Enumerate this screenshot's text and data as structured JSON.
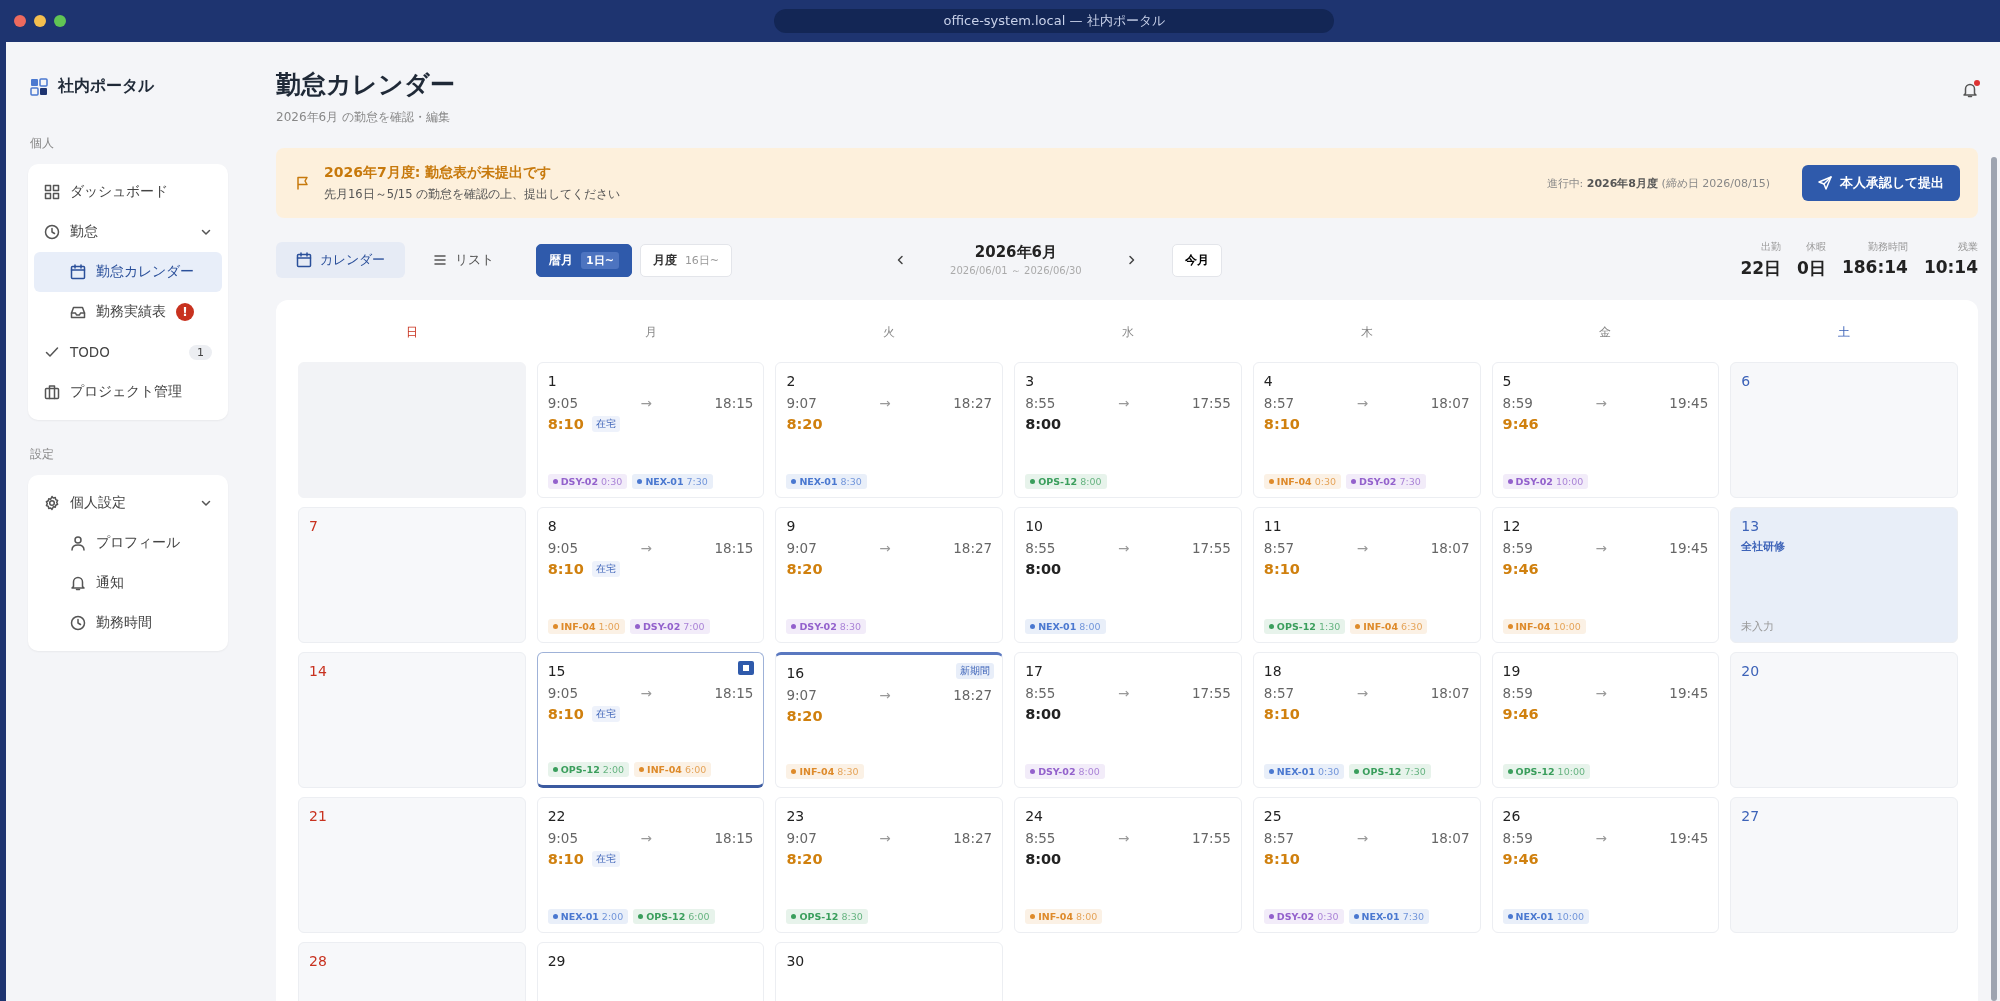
{
  "window": {
    "title": "office-system.local — 社内ポータル"
  },
  "sidebar": {
    "logo": "社内ポータル",
    "sections": [
      {
        "title": "個人",
        "items": [
          {
            "label": "ダッシュボード",
            "selected": false
          },
          {
            "label": "勤怠",
            "selected": false,
            "expanded": true,
            "children": [
              {
                "label": "勤怠カレンダー",
                "selected": true
              },
              {
                "label": "勤務実績表",
                "selected": false,
                "alert": "!"
              }
            ]
          },
          {
            "label": "TODO",
            "selected": false,
            "count": "1"
          },
          {
            "label": "プロジェクト管理",
            "selected": false
          }
        ]
      },
      {
        "title": "設定",
        "items": [
          {
            "label": "個人設定",
            "selected": false,
            "expanded": true,
            "children": [
              {
                "label": "プロフィール",
                "selected": false
              },
              {
                "label": "通知",
                "selected": false
              },
              {
                "label": "勤務時間",
                "selected": false
              }
            ]
          }
        ]
      }
    ]
  },
  "header": {
    "title": "勤怠カレンダー",
    "subtitle": "2026年6月 の勤怠を確認・編集",
    "unread": true
  },
  "banner": {
    "title": "2026年7月度: 勤怠表が未提出です",
    "message": "先月16日～5/15 の勤怠を確認の上、提出してください",
    "status": "進行中: **2026年8月度** (締め日 2026/08/15)",
    "button": "本人承認して提出"
  },
  "toolbar": {
    "views": [
      {
        "label": "カレンダー",
        "selected": true
      },
      {
        "label": "リスト",
        "selected": false
      }
    ],
    "periods": [
      {
        "label": "暦月",
        "sub": "1日~",
        "selected": true
      },
      {
        "label": "月度",
        "sub": "16日~",
        "selected": false
      }
    ],
    "month": "2026年6月",
    "range": "2026/06/01 ～ 2026/06/30",
    "today": "今月"
  },
  "stats": [
    {
      "label": "出勤",
      "value": "22日"
    },
    {
      "label": "休暇",
      "value": "0日"
    },
    {
      "label": "勤務時間",
      "value": "186:14"
    },
    {
      "label": "残業",
      "value": "10:14"
    }
  ],
  "calendar": {
    "weekdays": [
      {
        "label": "日",
        "kind": "sun"
      },
      {
        "label": "月",
        "kind": "weekday"
      },
      {
        "label": "火",
        "kind": "weekday"
      },
      {
        "label": "水",
        "kind": "weekday"
      },
      {
        "label": "木",
        "kind": "weekday"
      },
      {
        "label": "金",
        "kind": "weekday"
      },
      {
        "label": "土",
        "kind": "sat"
      }
    ],
    "weeks": [
      [
        {
          "kind": "blank"
        },
        {
          "kind": "work",
          "day": "1",
          "selected": false,
          "start": "9:05",
          "arrow": "→",
          "end": "18:15",
          "total": "8:10",
          "overtime": true,
          "remote": "在宅",
          "tags": [
            {
              "code": "DSY-02",
              "time": "0:30",
              "color": "#9361cc"
            },
            {
              "code": "NEX-01",
              "time": "7:30",
              "color": "#4a78d0"
            }
          ]
        },
        {
          "kind": "work",
          "day": "2",
          "selected": false,
          "start": "9:07",
          "arrow": "→",
          "end": "18:27",
          "total": "8:20",
          "overtime": true,
          "tags": [
            {
              "code": "NEX-01",
              "time": "8:30",
              "color": "#4a78d0"
            }
          ]
        },
        {
          "kind": "work",
          "day": "3",
          "selected": false,
          "start": "8:55",
          "arrow": "→",
          "end": "17:55",
          "total": "8:00",
          "overtime": false,
          "tags": [
            {
              "code": "OPS-12",
              "time": "8:00",
              "color": "#3a9e5c"
            }
          ]
        },
        {
          "kind": "work",
          "day": "4",
          "selected": false,
          "start": "8:57",
          "arrow": "→",
          "end": "18:07",
          "total": "8:10",
          "overtime": true,
          "tags": [
            {
              "code": "INF-04",
              "time": "0:30",
              "color": "#de8a2a"
            },
            {
              "code": "DSY-02",
              "time": "7:30",
              "color": "#9361cc"
            }
          ]
        },
        {
          "kind": "work",
          "day": "5",
          "selected": false,
          "start": "8:59",
          "arrow": "→",
          "end": "19:45",
          "total": "9:46",
          "overtime": true,
          "tags": [
            {
              "code": "DSY-02",
              "time": "10:00",
              "color": "#9361cc"
            }
          ]
        },
        {
          "kind": "off",
          "day": "6",
          "selected": false
        }
      ],
      [
        {
          "kind": "off",
          "day": "7",
          "selected": false
        },
        {
          "kind": "work",
          "day": "8",
          "selected": false,
          "start": "9:05",
          "arrow": "→",
          "end": "18:15",
          "total": "8:10",
          "overtime": true,
          "remote": "在宅",
          "tags": [
            {
              "code": "INF-04",
              "time": "1:00",
              "color": "#de8a2a"
            },
            {
              "code": "DSY-02",
              "time": "7:00",
              "color": "#9361cc"
            }
          ]
        },
        {
          "kind": "work",
          "day": "9",
          "selected": false,
          "start": "9:07",
          "arrow": "→",
          "end": "18:27",
          "total": "8:20",
          "overtime": true,
          "tags": [
            {
              "code": "DSY-02",
              "time": "8:30",
              "color": "#9361cc"
            }
          ]
        },
        {
          "kind": "work",
          "day": "10",
          "selected": false,
          "start": "8:55",
          "arrow": "→",
          "end": "17:55",
          "total": "8:00",
          "overtime": false,
          "tags": [
            {
              "code": "NEX-01",
              "time": "8:00",
              "color": "#4a78d0"
            }
          ]
        },
        {
          "kind": "work",
          "day": "11",
          "selected": false,
          "start": "8:57",
          "arrow": "→",
          "end": "18:07",
          "total": "8:10",
          "overtime": true,
          "tags": [
            {
              "code": "OPS-12",
              "time": "1:30",
              "color": "#3a9e5c"
            },
            {
              "code": "INF-04",
              "time": "6:30",
              "color": "#de8a2a"
            }
          ]
        },
        {
          "kind": "work",
          "day": "12",
          "selected": false,
          "start": "8:59",
          "arrow": "→",
          "end": "19:45",
          "total": "9:46",
          "overtime": true,
          "tags": [
            {
              "code": "INF-04",
              "time": "10:00",
              "color": "#de8a2a"
            }
          ]
        },
        {
          "kind": "off",
          "day": "13",
          "selected": false,
          "event": "全社研修",
          "status": "未入力"
        }
      ],
      [
        {
          "kind": "off",
          "day": "14",
          "selected": false
        },
        {
          "kind": "work",
          "day": "15",
          "selected": true,
          "flag": true,
          "start": "9:05",
          "arrow": "→",
          "end": "18:15",
          "total": "8:10",
          "overtime": true,
          "remote": "在宅",
          "tags": [
            {
              "code": "OPS-12",
              "time": "2:00",
              "color": "#3a9e5c"
            },
            {
              "code": "INF-04",
              "time": "6:00",
              "color": "#de8a2a"
            }
          ]
        },
        {
          "kind": "work",
          "day": "16",
          "selected": false,
          "period_start": true,
          "badge": "新期間",
          "start": "9:07",
          "arrow": "→",
          "end": "18:27",
          "total": "8:20",
          "overtime": true,
          "tags": [
            {
              "code": "INF-04",
              "time": "8:30",
              "color": "#de8a2a"
            }
          ]
        },
        {
          "kind": "work",
          "day": "17",
          "selected": false,
          "start": "8:55",
          "arrow": "→",
          "end": "17:55",
          "total": "8:00",
          "overtime": false,
          "tags": [
            {
              "code": "DSY-02",
              "time": "8:00",
              "color": "#9361cc"
            }
          ]
        },
        {
          "kind": "work",
          "day": "18",
          "selected": false,
          "start": "8:57",
          "arrow": "→",
          "end": "18:07",
          "total": "8:10",
          "overtime": true,
          "tags": [
            {
              "code": "NEX-01",
              "time": "0:30",
              "color": "#4a78d0"
            },
            {
              "code": "OPS-12",
              "time": "7:30",
              "color": "#3a9e5c"
            }
          ]
        },
        {
          "kind": "work",
          "day": "19",
          "selected": false,
          "start": "8:59",
          "arrow": "→",
          "end": "19:45",
          "total": "9:46",
          "overtime": true,
          "tags": [
            {
              "code": "OPS-12",
              "time": "10:00",
              "color": "#3a9e5c"
            }
          ]
        },
        {
          "kind": "off",
          "day": "20",
          "selected": false
        }
      ],
      [
        {
          "kind": "off",
          "day": "21",
          "selected": false
        },
        {
          "kind": "work",
          "day": "22",
          "selected": false,
          "start": "9:05",
          "arrow": "→",
          "end": "18:15",
          "total": "8:10",
          "overtime": true,
          "remote": "在宅",
          "tags": [
            {
              "code": "NEX-01",
              "time": "2:00",
              "color": "#4a78d0"
            },
            {
              "code": "OPS-12",
              "time": "6:00",
              "color": "#3a9e5c"
            }
          ]
        },
        {
          "kind": "work",
          "day": "23",
          "selected": false,
          "start": "9:07",
          "arrow": "→",
          "end": "18:27",
          "total": "8:20",
          "overtime": true,
          "tags": [
            {
              "code": "OPS-12",
              "time": "8:30",
              "color": "#3a9e5c"
            }
          ]
        },
        {
          "kind": "work",
          "day": "24",
          "selected": false,
          "start": "8:55",
          "arrow": "→",
          "end": "17:55",
          "total": "8:00",
          "overtime": false,
          "tags": [
            {
              "code": "INF-04",
              "time": "8:00",
              "color": "#de8a2a"
            }
          ]
        },
        {
          "kind": "work",
          "day": "25",
          "selected": false,
          "start": "8:57",
          "arrow": "→",
          "end": "18:07",
          "total": "8:10",
          "overtime": true,
          "tags": [
            {
              "code": "DSY-02",
              "time": "0:30",
              "color": "#9361cc"
            },
            {
              "code": "NEX-01",
              "time": "7:30",
              "color": "#4a78d0"
            }
          ]
        },
        {
          "kind": "work",
          "day": "26",
          "selected": false,
          "start": "8:59",
          "arrow": "→",
          "end": "19:45",
          "total": "9:46",
          "overtime": true,
          "tags": [
            {
              "code": "NEX-01",
              "time": "10:00",
              "color": "#4a78d0"
            }
          ]
        },
        {
          "kind": "off",
          "day": "27",
          "selected": false
        }
      ],
      [
        {
          "kind": "off",
          "day": "28",
          "selected": false
        },
        {
          "kind": "partial",
          "day": "29",
          "selected": false
        },
        {
          "kind": "partial",
          "day": "30",
          "selected": false
        },
        {
          "kind": "none"
        },
        {
          "kind": "none"
        },
        {
          "kind": "none"
        },
        {
          "kind": "none"
        }
      ]
    ]
  }
}
